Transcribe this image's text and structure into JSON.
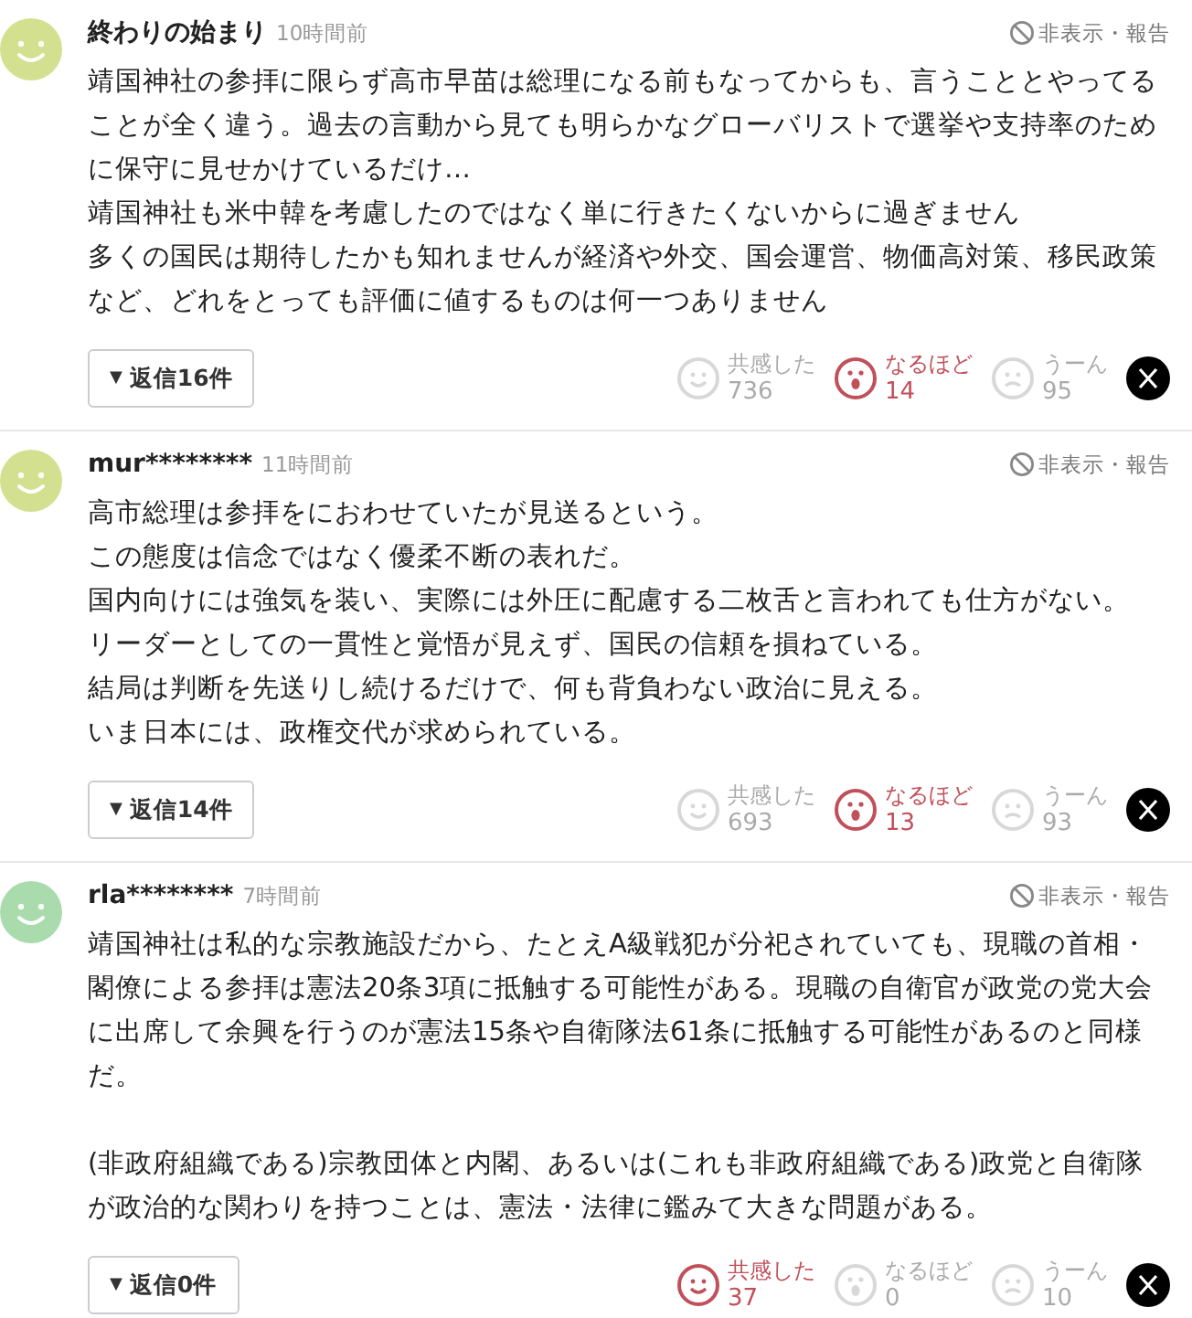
{
  "comments": [
    {
      "color": "#d3e08f",
      "author": "終わりの始まり",
      "time": "10時間前",
      "hide_report": "非表示・報告",
      "paragraphs": [
        [
          "靖国神社の参拝に限らず高市早苗は総理になる前もなってからも、言うこととやってることが全く違う。過去の言動から見ても明らかなグローバリストで選挙や支持率のために保守に見せかけているだけ…",
          "靖国神社も米中韓を考慮したのではなく単に行きたくないからに過ぎません",
          "多くの国民は期待したかも知れませんが経済や外交、国会運営、物価高対策、移民政策など、どれをとっても評価に値するものは何一つありません"
        ]
      ],
      "reply_caret": "▼",
      "reply_label": "返信16件",
      "reactions": [
        {
          "kind": "empathy",
          "label": "共感した",
          "count": "736",
          "selected": false
        },
        {
          "kind": "insight",
          "label": "なるほど",
          "count": "14",
          "selected": true
        },
        {
          "kind": "hmm",
          "label": "うーん",
          "count": "95",
          "selected": false
        }
      ]
    },
    {
      "color": "#d3e08f",
      "author": "mur********",
      "time": "11時間前",
      "hide_report": "非表示・報告",
      "paragraphs": [
        [
          "高市総理は参拝をにおわせていたが見送るという。",
          "この態度は信念ではなく優柔不断の表れだ。",
          "国内向けには強気を装い、実際には外圧に配慮する二枚舌と言われても仕方がない。",
          "リーダーとしての一貫性と覚悟が見えず、国民の信頼を損ねている。",
          "結局は判断を先送りし続けるだけで、何も背負わない政治に見える。",
          "いま日本には、政権交代が求められている。"
        ]
      ],
      "reply_caret": "▼",
      "reply_label": "返信14件",
      "reactions": [
        {
          "kind": "empathy",
          "label": "共感した",
          "count": "693",
          "selected": false
        },
        {
          "kind": "insight",
          "label": "なるほど",
          "count": "13",
          "selected": true
        },
        {
          "kind": "hmm",
          "label": "うーん",
          "count": "93",
          "selected": false
        }
      ]
    },
    {
      "color": "#a9dbad",
      "author": "rla********",
      "time": "7時間前",
      "hide_report": "非表示・報告",
      "paragraphs": [
        [
          "靖国神社は私的な宗教施設だから、たとえA級戦犯が分祀されていても、現職の首相・閣僚による参拝は憲法20条3項に抵触する可能性がある。現職の自衛官が政党の党大会に出席して余興を行うのが憲法15条や自衛隊法61条に抵触する可能性があるのと同様だ。"
        ],
        [
          "(非政府組織である)宗教団体と内閣、あるいは(これも非政府組織である)政党と自衛隊が政治的な関わりを持つことは、憲法・法律に鑑みて大きな問題がある。"
        ]
      ],
      "reply_caret": "▼",
      "reply_label": "返信0件",
      "reactions": [
        {
          "kind": "empathy",
          "label": "共感した",
          "count": "37",
          "selected": true
        },
        {
          "kind": "insight",
          "label": "なるほど",
          "count": "0",
          "selected": false
        },
        {
          "kind": "hmm",
          "label": "うーん",
          "count": "10",
          "selected": false
        }
      ]
    }
  ]
}
